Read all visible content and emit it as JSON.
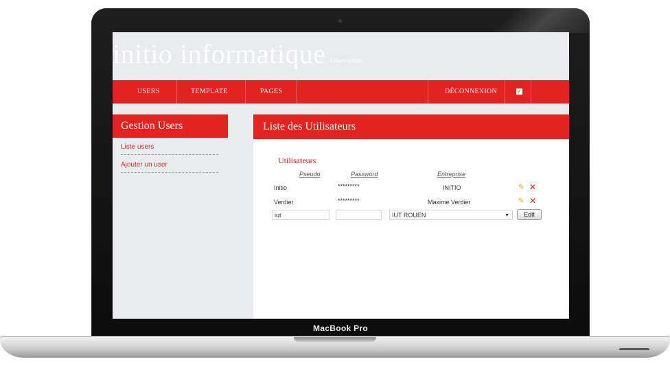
{
  "device": {
    "brand_label": "MacBook Pro"
  },
  "header": {
    "site_name": "initio informatique",
    "tagline": "Informatique"
  },
  "nav": {
    "items": [
      "USERS",
      "TEMPLATE",
      "PAGES"
    ],
    "logout": "DÉCONNEXION",
    "check_icon": "checkbox-icon"
  },
  "sidebar": {
    "title": "Gestion Users",
    "links": [
      "Liste users",
      "Ajouter un user"
    ]
  },
  "main": {
    "title": "Liste des Utilisateurs",
    "table": {
      "caption": "Utilisateurs",
      "columns": [
        "Pseudo",
        "Password",
        "Entreprise"
      ],
      "rows": [
        {
          "pseudo": "Initio",
          "password": "*********",
          "entreprise": "INITIO"
        },
        {
          "pseudo": "Verdier",
          "password": "*********",
          "entreprise": "Maxime Verdier"
        }
      ],
      "new_row": {
        "pseudo_value": "iut",
        "password_value": "",
        "entreprise_selected": "IUT ROUEN",
        "button_label": "Edit"
      }
    },
    "row_actions": {
      "edit_icon": "pencil-icon",
      "delete_icon": "close-icon"
    }
  },
  "colors": {
    "accent": "#e2231f",
    "screen_bg": "#e9ebee",
    "link": "#c0392b"
  }
}
